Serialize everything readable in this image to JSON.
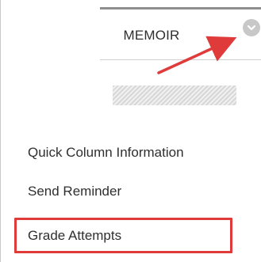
{
  "column": {
    "title": "MEMOIR",
    "menu_icon": "chevron-down-icon"
  },
  "menu": {
    "items": [
      {
        "label": "Quick Column Information"
      },
      {
        "label": "Send Reminder"
      },
      {
        "label": "Grade Attempts"
      }
    ]
  },
  "annotations": {
    "arrow_color": "#e03b3b",
    "highlight_color": "#e03b3b"
  }
}
